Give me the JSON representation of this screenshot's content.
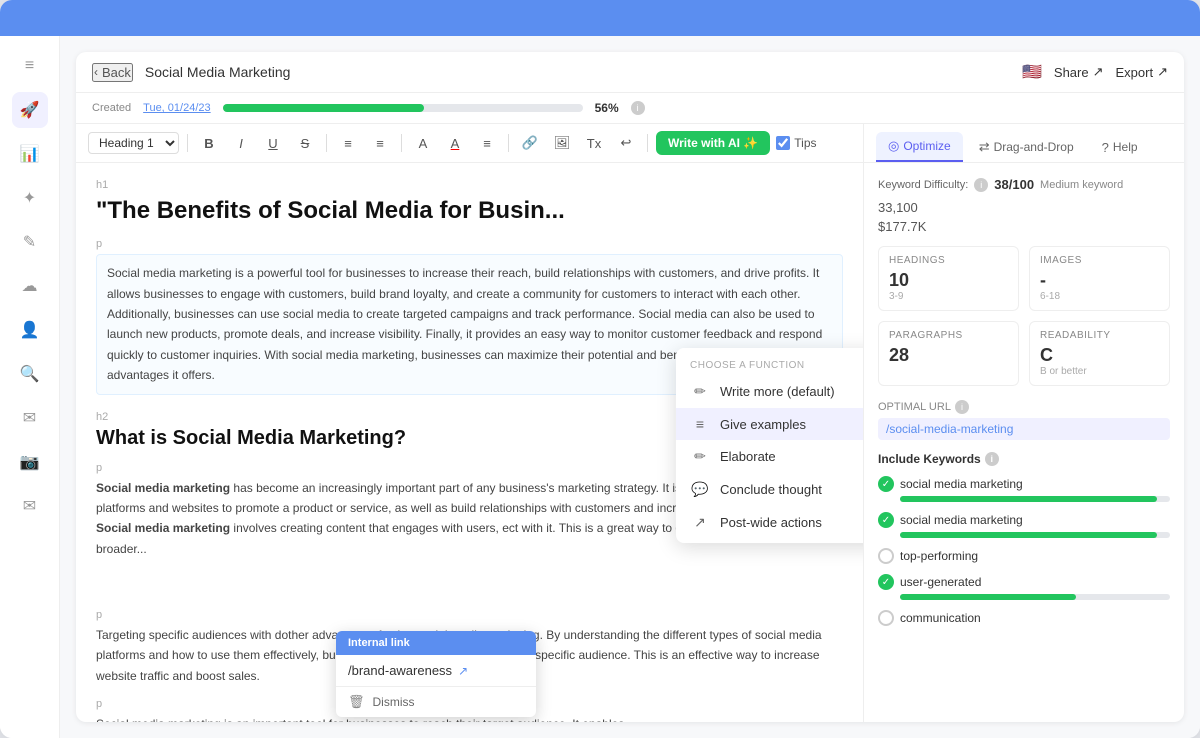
{
  "topBar": {},
  "sidebar": {
    "icons": [
      "≡",
      "🚀",
      "📊",
      "✦",
      "✎",
      "☁",
      "👤",
      "🔍",
      "✉",
      "📷",
      "✉"
    ]
  },
  "header": {
    "back_label": "Back",
    "title": "Social Media Marketing",
    "flag": "🇺🇸",
    "share_label": "Share",
    "export_label": "Export"
  },
  "progress": {
    "created_label": "Created",
    "created_date": "Tue, 01/24/23",
    "percent": "56%",
    "info": "i"
  },
  "toolbar": {
    "heading_select": "Heading 1",
    "bold": "B",
    "italic": "I",
    "underline": "U",
    "strike": "S",
    "ordered_list": "≡",
    "unordered_list": "≡",
    "font_color": "A",
    "font_bg": "A",
    "align": "≡",
    "link": "🔗",
    "image": "🖼",
    "clear": "Tx",
    "undo": "↩",
    "write_ai": "Write with AI ✨",
    "tips_label": "Tips"
  },
  "document": {
    "h1_tag": "h1",
    "heading": "\"The Benefits of Social Media for Busin...",
    "p_tag": "p",
    "para1": "Social media marketing is a powerful tool for businesses to increase their reach, build relationships with customers, and drive profits. It allows businesses to engage with customers, build brand loyalty, and create a community for customers to interact with each other. Additionally, businesses can use social media to create targeted campaigns and track performance. Social media can also be used to launch new products, promote deals, and increase visibility. Finally, it provides an easy way to monitor customer feedback and respond quickly to customer inquiries. With social media marketing, businesses can maximize their potential and benefit from the powerful advantages it offers.",
    "h2_tag": "h2",
    "h2_heading": "What is Social Media Marketing?",
    "para2_start": "Social media marketing has become an increasingly important part of any business's marketing strategy. It is the use of social media platforms and websites to promote a product or service, as well as build relationships with customers and increase ",
    "para2_link": "brand awareness",
    "para2_mid": ". Social media marketing involves creating content that engages with users, e",
    "para2_end": "ct with it. This is a great way to get your message out to a broader...",
    "p3_tag": "p",
    "para3_start": "Targeting specific audiences with d",
    "para3_end": "other advantage of using social media marketing. By understanding the different types of social media platforms and how to use them effectively, businesses can target their content to a specific audience. This is an effective way to increase website traffic and boost sales.",
    "p4_tag": "p",
    "para4": "Social media marketing is an important tool for businesses to reach their target audience. It enables"
  },
  "internal_link_popup": {
    "header": "Internal link",
    "url": "/brand-awareness",
    "dismiss": "Dismiss"
  },
  "ai_dropdown": {
    "header": "Choose a function",
    "items": [
      {
        "icon": "✏️",
        "label": "Write more (default)"
      },
      {
        "icon": "≡",
        "label": "Give examples"
      },
      {
        "icon": "✏",
        "label": "Elaborate"
      },
      {
        "icon": "💬",
        "label": "Conclude thought"
      },
      {
        "icon": "↗",
        "label": "Post-wide actions"
      }
    ]
  },
  "right_panel": {
    "tabs": [
      {
        "label": "Optimize",
        "icon": "◎",
        "active": true
      },
      {
        "label": "Drag-and-Drop",
        "icon": "⇄",
        "active": false
      },
      {
        "label": "Help",
        "icon": "?",
        "active": false
      }
    ],
    "keyword_difficulty_label": "Keyword Difficulty:",
    "kw_score": "38/100",
    "kw_medium": "Medium keyword",
    "kw_number": "33,100",
    "kw_value": "$177.7K",
    "stats": [
      {
        "label": "HEADINGS",
        "value": "10",
        "range": "3-9"
      },
      {
        "label": "IMAGES",
        "value": "-",
        "range": "6-18"
      },
      {
        "label": "PARAGRAPHS",
        "value": "28",
        "range": ""
      },
      {
        "label": "READABILITY",
        "value": "C",
        "range": "B or better"
      }
    ],
    "optimal_url_label": "OPTIMAL URL",
    "optimal_url": "/social-media-marketing",
    "include_keywords_label": "Include Keywords",
    "keywords": [
      {
        "name": "social media marketing",
        "checked": true,
        "bar": "full"
      },
      {
        "name": "social media marketing",
        "checked": true,
        "bar": "full"
      },
      {
        "name": "top-performing",
        "checked": false,
        "bar": "none"
      },
      {
        "name": "user-generated",
        "checked": true,
        "bar": "medium"
      },
      {
        "name": "communication",
        "checked": false,
        "bar": "none"
      }
    ]
  }
}
